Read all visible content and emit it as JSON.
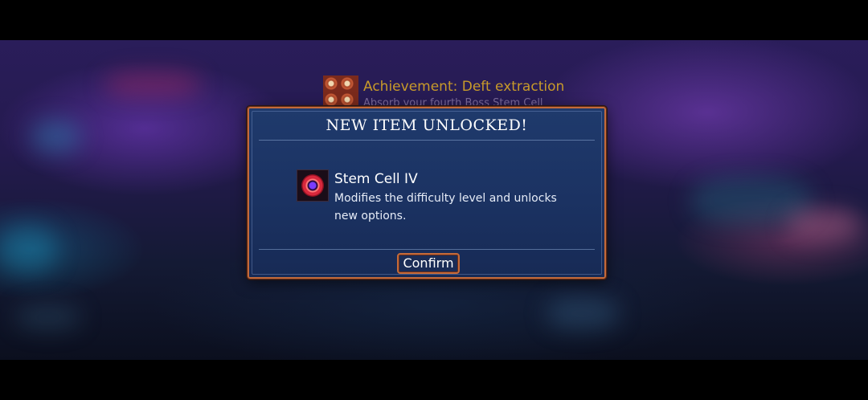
{
  "achievement": {
    "title": "Achievement: Deft extraction",
    "subtitle": "Absorb your fourth Boss Stem Cell",
    "icon": "stem-cell-achievement-icon"
  },
  "dialog": {
    "title": "NEW ITEM UNLOCKED!",
    "item": {
      "name": "Stem Cell IV",
      "description": "Modifies the difficulty level and unlocks new options.",
      "icon": "stem-cell-icon"
    },
    "confirm_label": "Confirm"
  },
  "colors": {
    "dialog_border": "#c46a3a",
    "dialog_bg": "#1b3262",
    "achievement_text": "#c89a2a"
  }
}
